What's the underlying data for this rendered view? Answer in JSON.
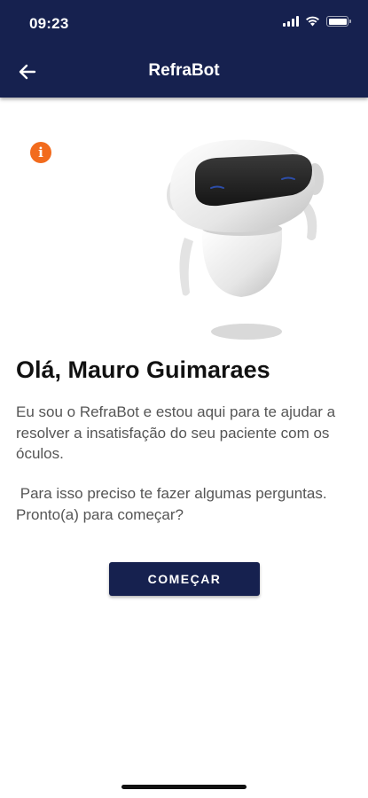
{
  "status_bar": {
    "time": "09:23"
  },
  "nav": {
    "title": "RefraBot",
    "back_icon": "arrow-left-icon"
  },
  "info": {
    "icon": "info-icon",
    "glyph": "i",
    "color": "#f26b1d"
  },
  "content": {
    "greeting": "Olá, Mauro Guimaraes",
    "intro": "Eu sou o RefraBot e estou aqui para te ajudar a resolver a insatisfação do seu paciente com os óculos.",
    "question": " Para isso preciso te fazer algumas perguntas. Pronto(a) para começar?",
    "start_button": "COMEÇAR"
  },
  "colors": {
    "header": "#16214f",
    "accent": "#f26b1d",
    "button": "#16214f"
  }
}
